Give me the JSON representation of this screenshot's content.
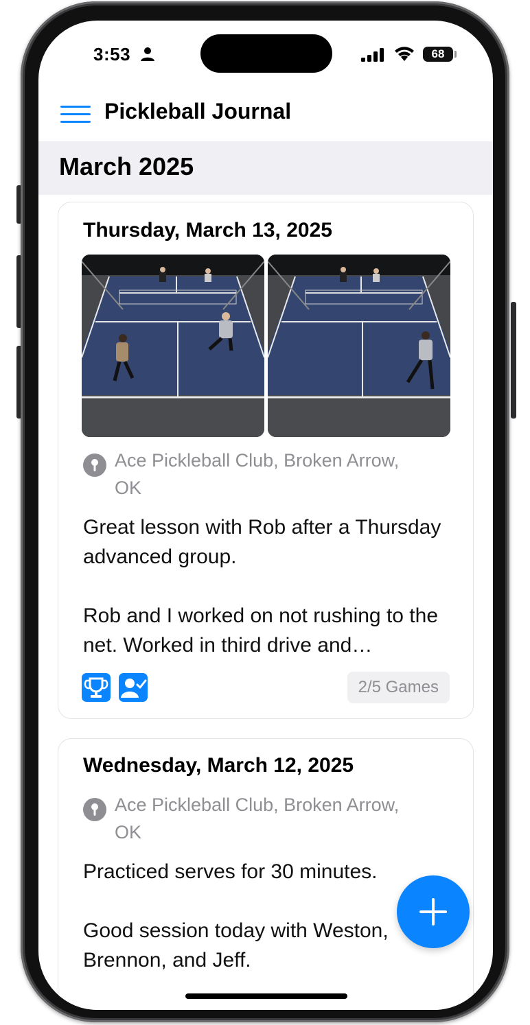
{
  "status_bar": {
    "time": "3:53",
    "battery": "68"
  },
  "nav": {
    "title": "Pickleball Journal"
  },
  "month_header": {
    "title": "March 2025"
  },
  "entries": [
    {
      "date": "Thursday, March 13, 2025",
      "location": "Ace Pickleball Club, Broken Arrow, OK",
      "notes_line1": "Great lesson with Rob after a Thursday advanced group.",
      "notes_line2": "Rob and I worked on not rushing to the net. Worked in third drive and…",
      "games": "2/5 Games",
      "badges": [
        "trophy-icon",
        "person-check-icon"
      ]
    },
    {
      "date": "Wednesday, March 12, 2025",
      "location": "Ace Pickleball Club, Broken Arrow, OK",
      "notes_line1": "Practiced serves for 30 minutes.",
      "notes_line2": "Good session today with Weston, Brennon, and Jeff."
    }
  ],
  "colors": {
    "accent": "#0a84ff",
    "secondary_text": "#8e8e93",
    "section_bg": "#efeff4"
  }
}
